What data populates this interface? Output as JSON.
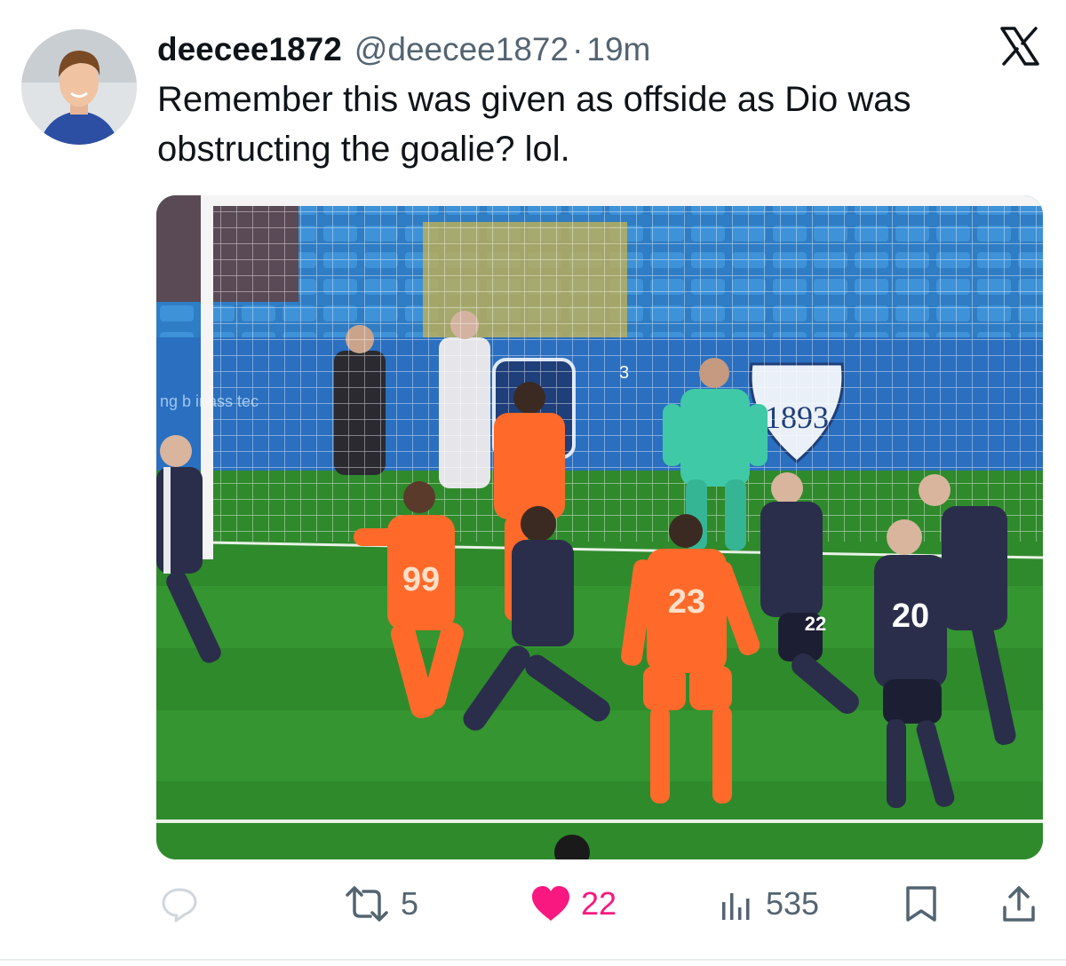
{
  "tweet": {
    "display_name": "deecee1872",
    "handle": "@deecee1872",
    "separator": "·",
    "time": "19m",
    "text": "Remember this was given as offside as Dio was obstructing the goalie? lol."
  },
  "media": {
    "stadium_sign": "1893",
    "ad_board_text": "ng b  inass tec",
    "post_number": "3",
    "jersey_numbers": [
      "99",
      "23",
      "20",
      "22"
    ]
  },
  "actions": {
    "reply": {
      "icon": "reply-icon",
      "count": ""
    },
    "repost": {
      "icon": "repost-icon",
      "count": "5"
    },
    "like": {
      "icon": "heart-icon",
      "count": "22",
      "liked": true
    },
    "views": {
      "icon": "views-icon",
      "count": "535"
    },
    "bookmark": {
      "icon": "bookmark-icon"
    },
    "share": {
      "icon": "share-icon"
    }
  },
  "colors": {
    "like_active": "#f91880",
    "secondary_text": "#536471",
    "primary_text": "#0f1419",
    "home_kit": "#ff6a2b",
    "away_kit": "#2a2e4a",
    "keeper_kit": "#3fc9a6",
    "pitch": "#2f8a2c",
    "stands": "#2f7dc4"
  }
}
